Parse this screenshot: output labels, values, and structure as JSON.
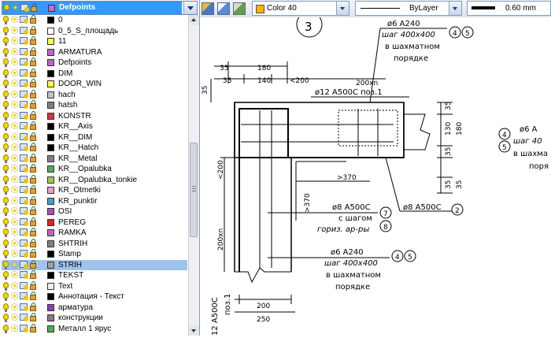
{
  "layer_panel": {
    "current_layer": "Defpoints",
    "current_color": "#cc66cc",
    "layers": [
      {
        "name": "0",
        "color": "#000000"
      },
      {
        "name": "0_5_S_площадь",
        "color": "#ffffff"
      },
      {
        "name": "11",
        "color": "#ffff33"
      },
      {
        "name": "ARMATURA",
        "color": "#c066c0"
      },
      {
        "name": "Defpoints",
        "color": "#c066c0"
      },
      {
        "name": "DIM",
        "color": "#000000"
      },
      {
        "name": "DOOR_WIN",
        "color": "#ffff33"
      },
      {
        "name": "hach",
        "color": "#c0c0c0"
      },
      {
        "name": "hatsh",
        "color": "#808080"
      },
      {
        "name": "KONSTR",
        "color": "#e03030"
      },
      {
        "name": "KR__Axis",
        "color": "#000000"
      },
      {
        "name": "KR__DIM",
        "color": "#000000"
      },
      {
        "name": "KR__Hatch",
        "color": "#000000"
      },
      {
        "name": "KR__Metal",
        "color": "#808080"
      },
      {
        "name": "KR__Opalubka",
        "color": "#4caf50"
      },
      {
        "name": "KR__Opalubka_tonkie",
        "color": "#a0c850"
      },
      {
        "name": "KR_Otmetki",
        "color": "#e8a0c8"
      },
      {
        "name": "KR_punktir",
        "color": "#40a0d0"
      },
      {
        "name": "OSI",
        "color": "#b04fb0"
      },
      {
        "name": "PEREG",
        "color": "#e02020"
      },
      {
        "name": "RAMKA",
        "color": "#c066c0"
      },
      {
        "name": "SHTRIH",
        "color": "#808080"
      },
      {
        "name": "Stamp",
        "color": "#000000"
      },
      {
        "name": "STRIH",
        "color": "#a0a0a0"
      },
      {
        "name": "TEKST",
        "color": "#000000"
      },
      {
        "name": "Text",
        "color": "#f0f0f0"
      },
      {
        "name": "Аннотация - Текст",
        "color": "#000000"
      },
      {
        "name": "арматура",
        "color": "#8a3fb0"
      },
      {
        "name": "конструкции",
        "color": "#808080"
      },
      {
        "name": "Металл 1 ярус",
        "color": "#4caf50"
      }
    ],
    "selected_layer": "STRIH"
  },
  "toolbar": {
    "color_label": "Color 40",
    "color_value": "#f5b400",
    "linetype_label": "ByLayer",
    "lineweight_label": "0.60 mm"
  },
  "drawing": {
    "section_marker": "3",
    "top_rebar_line1": "ø6 A240",
    "top_rebar_line2": "шаг 400x400",
    "top_rebar_line3": "в шахматном",
    "top_rebar_line4": "порядке",
    "top_callout_a": "4",
    "top_callout_b": "5",
    "dim_35_a": "35",
    "dim_180_top": "180",
    "dim_35_b": "35",
    "dim_140": "140",
    "dim_lt200_top": "<200",
    "dim_200xn": "200xn",
    "dim_35_left": "35",
    "rebar_12_label": "ø12 А500С поз.1",
    "dim_35_r1": "35",
    "dim_130": "130",
    "dim_180_right": "180",
    "dim_35_r2": "35",
    "dim_35_r3": "35",
    "dim_35_r4": "35",
    "dim_lt200_left": "<200",
    "dim_gt370_h": ">370",
    "dim_gt370_v": ">370",
    "rebar_8_right": "ø8 А500С",
    "callout_2": "2",
    "rebar_8_mid_line1": "ø8 А500С",
    "rebar_8_mid_line2": "с шагом",
    "rebar_8_mid_line3": "гориз. ар-ры",
    "callout_7": "7",
    "callout_8": "8",
    "dim_200xn_left": "200xn",
    "bottom_rebar_line1": "ø6 A240",
    "bottom_rebar_line2": "шаг 400x400",
    "bottom_rebar_line3": "в шахматном",
    "bottom_rebar_line4": "порядке",
    "bottom_callout_a": "4",
    "bottom_callout_b": "5",
    "dim_200_bottom": "200",
    "dim_250_bottom": "250",
    "left_vertical_1": "12 А500С",
    "left_vertical_2": "поз.1",
    "right_fragment_line1": "ø6 A",
    "right_fragment_line2": "шаг 40",
    "right_fragment_line3": "в шахма",
    "right_fragment_line4": "поря",
    "right_callout_a": "4",
    "right_callout_b": "5"
  }
}
